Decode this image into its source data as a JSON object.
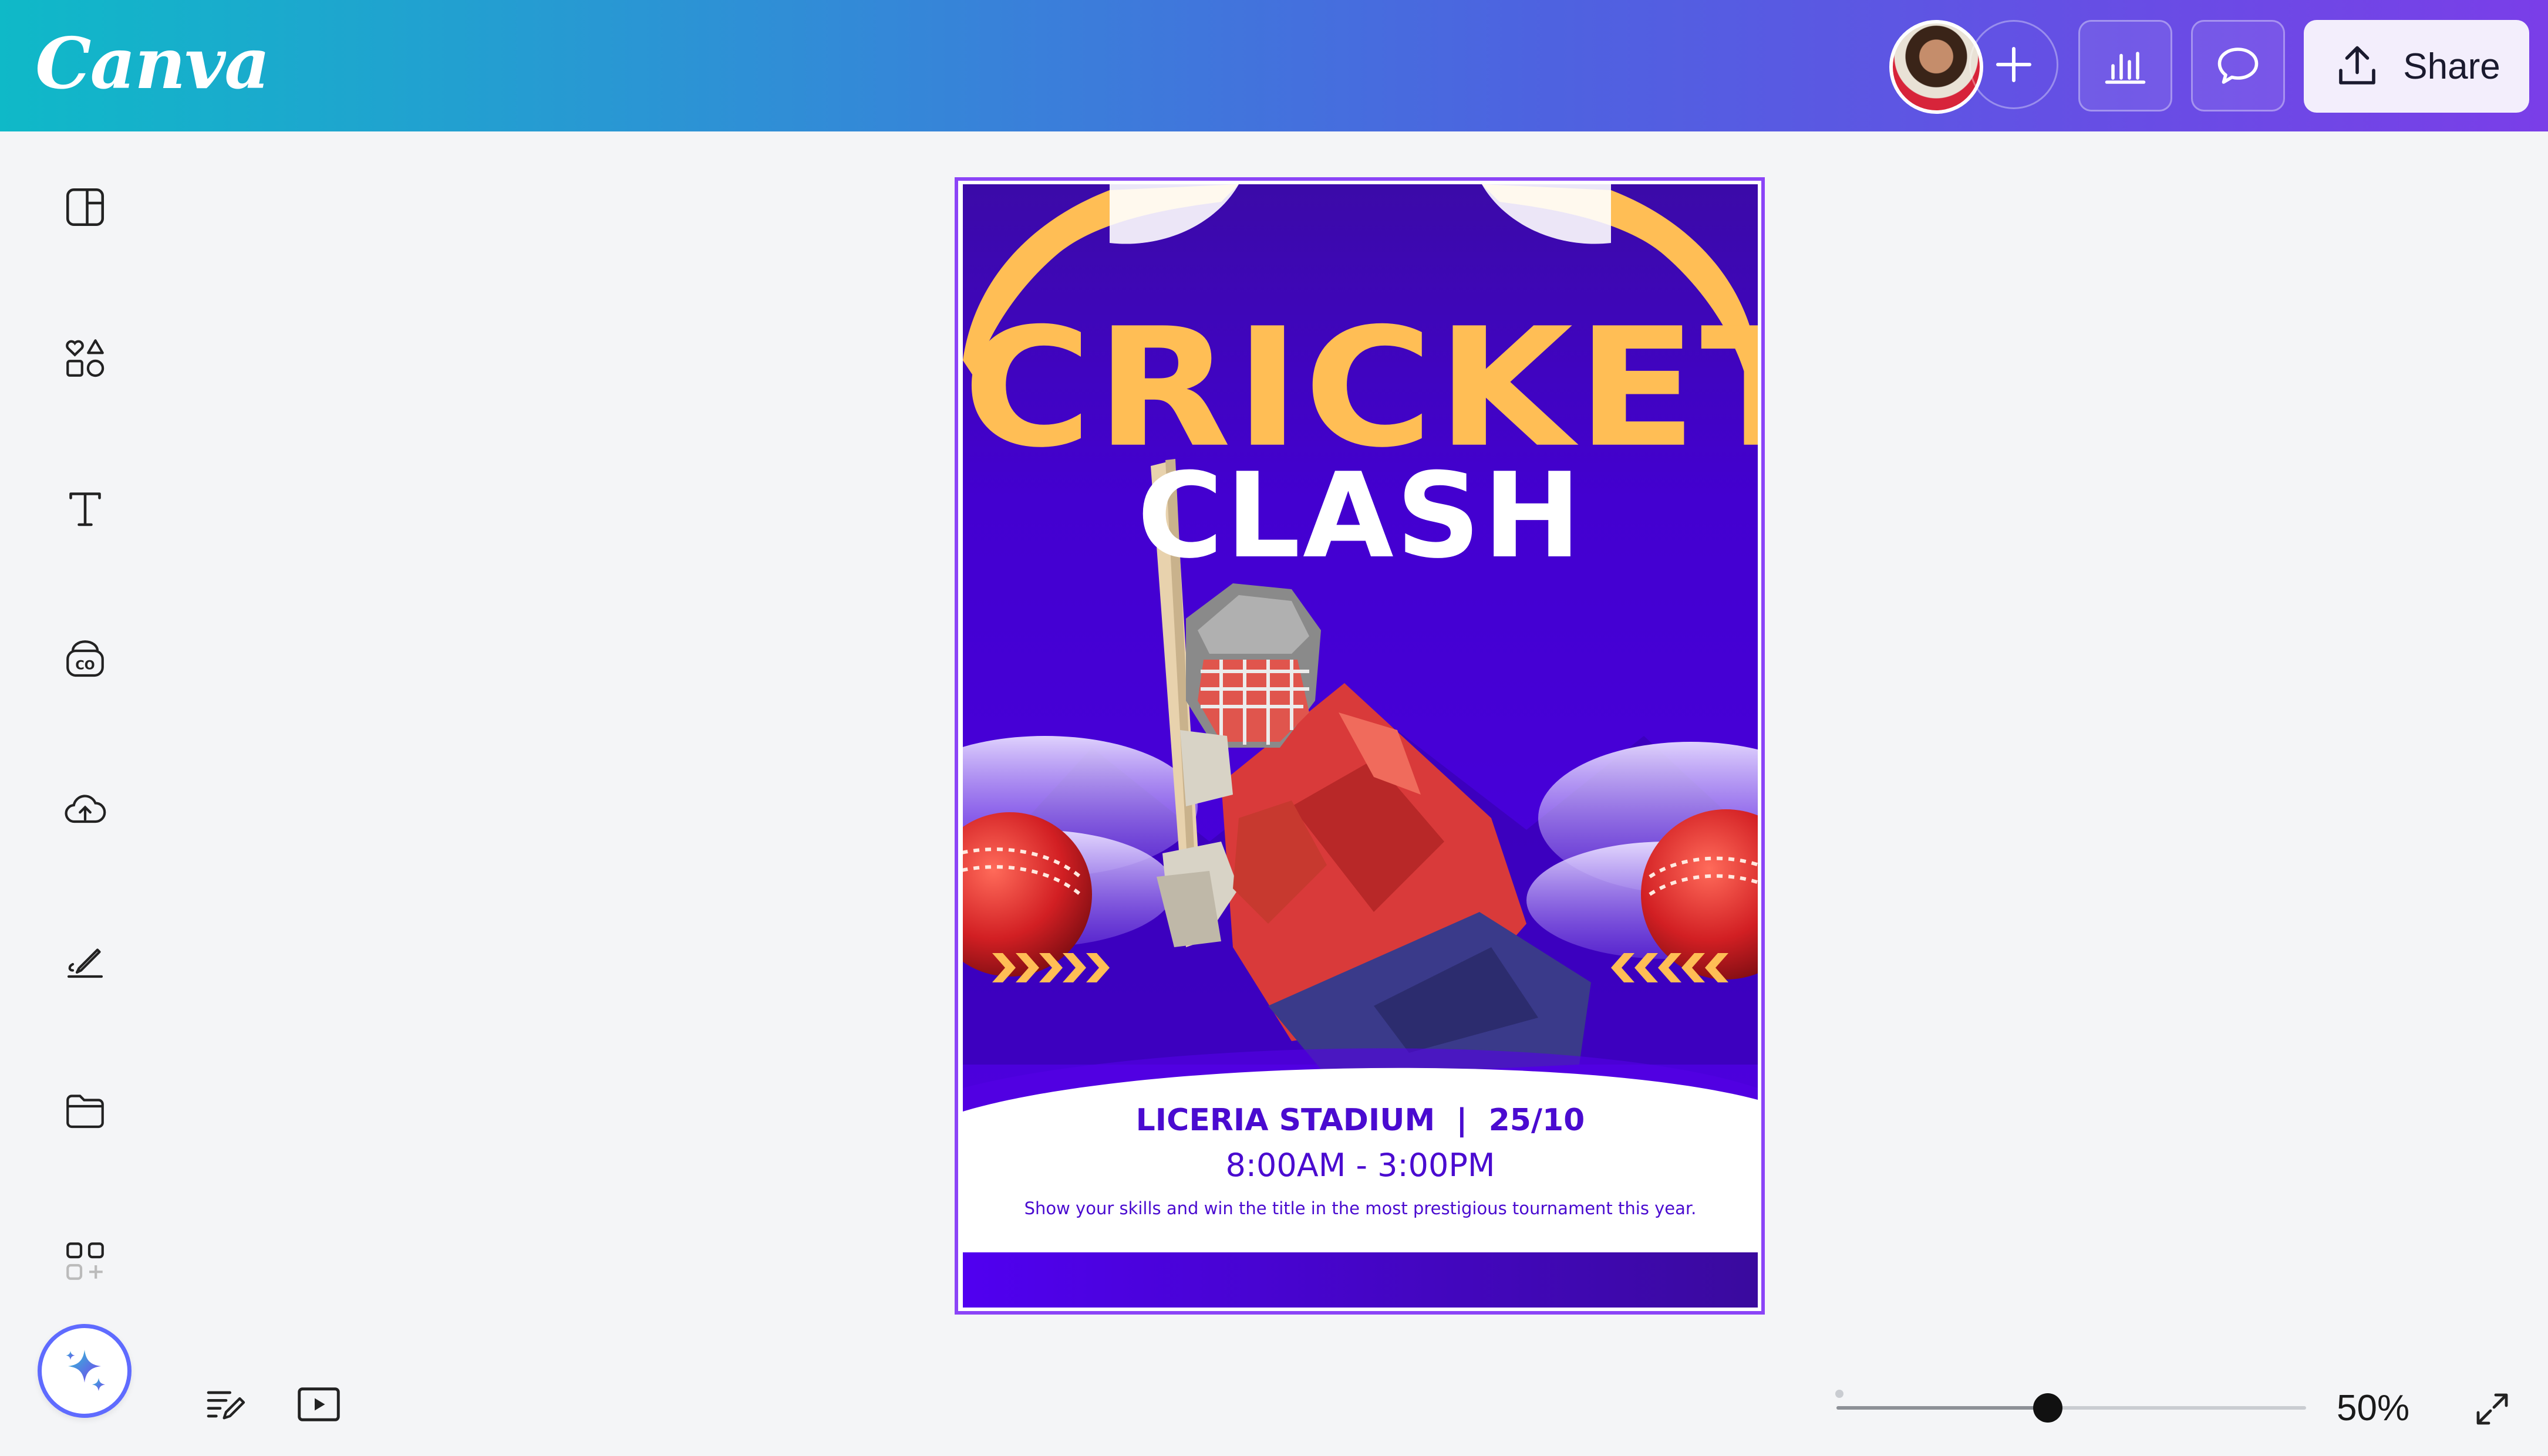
{
  "app": {
    "logo": "Canva"
  },
  "header": {
    "share_label": "Share",
    "avatar_icon": "user-avatar",
    "add_collaborator_icon": "plus-icon",
    "analytics_icon": "bar-chart-icon",
    "comment_icon": "comment-icon",
    "share_icon": "upload-icon"
  },
  "sidebar": {
    "items": [
      {
        "icon": "design-panel-icon"
      },
      {
        "icon": "elements-shapes-icon"
      },
      {
        "icon": "text-icon"
      },
      {
        "icon": "brand-icon"
      },
      {
        "icon": "uploads-cloud-icon"
      },
      {
        "icon": "draw-icon"
      },
      {
        "icon": "projects-folder-icon"
      },
      {
        "icon": "apps-icon"
      }
    ],
    "magic_icon": "sparkle-icon"
  },
  "poster": {
    "title_top": "CRICKET",
    "title_bottom": "CLASH",
    "venue_line": "LICERIA STADIUM  |  25/10",
    "time_line": "8:00AM - 3:00PM",
    "tagline": "Show your skills and win the title in the most prestigious tournament this year.",
    "colors": {
      "background": "#4700d9",
      "accent": "#ffbe55",
      "text": "#4a0bd0"
    }
  },
  "bottom_bar": {
    "notes_icon": "notes-icon",
    "present_icon": "play-icon",
    "zoom": {
      "value_percent": 50,
      "label": "50%",
      "slider_fraction": 0.45
    },
    "fullscreen_icon": "expand-icon"
  },
  "theme": {
    "header_gradient": [
      "#0fb9c8",
      "#7a3ee8"
    ],
    "selection": "#8b44f7"
  }
}
